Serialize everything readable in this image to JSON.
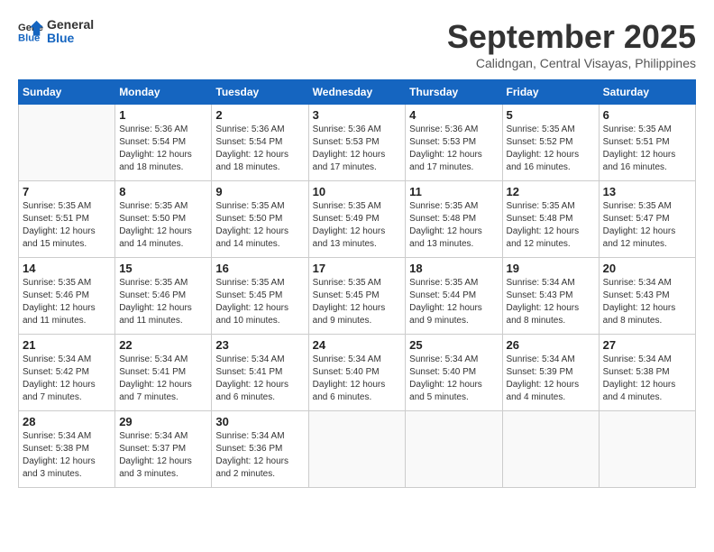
{
  "header": {
    "logo_line1": "General",
    "logo_line2": "Blue",
    "month_title": "September 2025",
    "subtitle": "Calidngan, Central Visayas, Philippines"
  },
  "days_of_week": [
    "Sunday",
    "Monday",
    "Tuesday",
    "Wednesday",
    "Thursday",
    "Friday",
    "Saturday"
  ],
  "weeks": [
    [
      {
        "day": "",
        "info": ""
      },
      {
        "day": "1",
        "info": "Sunrise: 5:36 AM\nSunset: 5:54 PM\nDaylight: 12 hours\nand 18 minutes."
      },
      {
        "day": "2",
        "info": "Sunrise: 5:36 AM\nSunset: 5:54 PM\nDaylight: 12 hours\nand 18 minutes."
      },
      {
        "day": "3",
        "info": "Sunrise: 5:36 AM\nSunset: 5:53 PM\nDaylight: 12 hours\nand 17 minutes."
      },
      {
        "day": "4",
        "info": "Sunrise: 5:36 AM\nSunset: 5:53 PM\nDaylight: 12 hours\nand 17 minutes."
      },
      {
        "day": "5",
        "info": "Sunrise: 5:35 AM\nSunset: 5:52 PM\nDaylight: 12 hours\nand 16 minutes."
      },
      {
        "day": "6",
        "info": "Sunrise: 5:35 AM\nSunset: 5:51 PM\nDaylight: 12 hours\nand 16 minutes."
      }
    ],
    [
      {
        "day": "7",
        "info": "Sunrise: 5:35 AM\nSunset: 5:51 PM\nDaylight: 12 hours\nand 15 minutes."
      },
      {
        "day": "8",
        "info": "Sunrise: 5:35 AM\nSunset: 5:50 PM\nDaylight: 12 hours\nand 14 minutes."
      },
      {
        "day": "9",
        "info": "Sunrise: 5:35 AM\nSunset: 5:50 PM\nDaylight: 12 hours\nand 14 minutes."
      },
      {
        "day": "10",
        "info": "Sunrise: 5:35 AM\nSunset: 5:49 PM\nDaylight: 12 hours\nand 13 minutes."
      },
      {
        "day": "11",
        "info": "Sunrise: 5:35 AM\nSunset: 5:48 PM\nDaylight: 12 hours\nand 13 minutes."
      },
      {
        "day": "12",
        "info": "Sunrise: 5:35 AM\nSunset: 5:48 PM\nDaylight: 12 hours\nand 12 minutes."
      },
      {
        "day": "13",
        "info": "Sunrise: 5:35 AM\nSunset: 5:47 PM\nDaylight: 12 hours\nand 12 minutes."
      }
    ],
    [
      {
        "day": "14",
        "info": "Sunrise: 5:35 AM\nSunset: 5:46 PM\nDaylight: 12 hours\nand 11 minutes."
      },
      {
        "day": "15",
        "info": "Sunrise: 5:35 AM\nSunset: 5:46 PM\nDaylight: 12 hours\nand 11 minutes."
      },
      {
        "day": "16",
        "info": "Sunrise: 5:35 AM\nSunset: 5:45 PM\nDaylight: 12 hours\nand 10 minutes."
      },
      {
        "day": "17",
        "info": "Sunrise: 5:35 AM\nSunset: 5:45 PM\nDaylight: 12 hours\nand 9 minutes."
      },
      {
        "day": "18",
        "info": "Sunrise: 5:35 AM\nSunset: 5:44 PM\nDaylight: 12 hours\nand 9 minutes."
      },
      {
        "day": "19",
        "info": "Sunrise: 5:34 AM\nSunset: 5:43 PM\nDaylight: 12 hours\nand 8 minutes."
      },
      {
        "day": "20",
        "info": "Sunrise: 5:34 AM\nSunset: 5:43 PM\nDaylight: 12 hours\nand 8 minutes."
      }
    ],
    [
      {
        "day": "21",
        "info": "Sunrise: 5:34 AM\nSunset: 5:42 PM\nDaylight: 12 hours\nand 7 minutes."
      },
      {
        "day": "22",
        "info": "Sunrise: 5:34 AM\nSunset: 5:41 PM\nDaylight: 12 hours\nand 7 minutes."
      },
      {
        "day": "23",
        "info": "Sunrise: 5:34 AM\nSunset: 5:41 PM\nDaylight: 12 hours\nand 6 minutes."
      },
      {
        "day": "24",
        "info": "Sunrise: 5:34 AM\nSunset: 5:40 PM\nDaylight: 12 hours\nand 6 minutes."
      },
      {
        "day": "25",
        "info": "Sunrise: 5:34 AM\nSunset: 5:40 PM\nDaylight: 12 hours\nand 5 minutes."
      },
      {
        "day": "26",
        "info": "Sunrise: 5:34 AM\nSunset: 5:39 PM\nDaylight: 12 hours\nand 4 minutes."
      },
      {
        "day": "27",
        "info": "Sunrise: 5:34 AM\nSunset: 5:38 PM\nDaylight: 12 hours\nand 4 minutes."
      }
    ],
    [
      {
        "day": "28",
        "info": "Sunrise: 5:34 AM\nSunset: 5:38 PM\nDaylight: 12 hours\nand 3 minutes."
      },
      {
        "day": "29",
        "info": "Sunrise: 5:34 AM\nSunset: 5:37 PM\nDaylight: 12 hours\nand 3 minutes."
      },
      {
        "day": "30",
        "info": "Sunrise: 5:34 AM\nSunset: 5:36 PM\nDaylight: 12 hours\nand 2 minutes."
      },
      {
        "day": "",
        "info": ""
      },
      {
        "day": "",
        "info": ""
      },
      {
        "day": "",
        "info": ""
      },
      {
        "day": "",
        "info": ""
      }
    ]
  ]
}
